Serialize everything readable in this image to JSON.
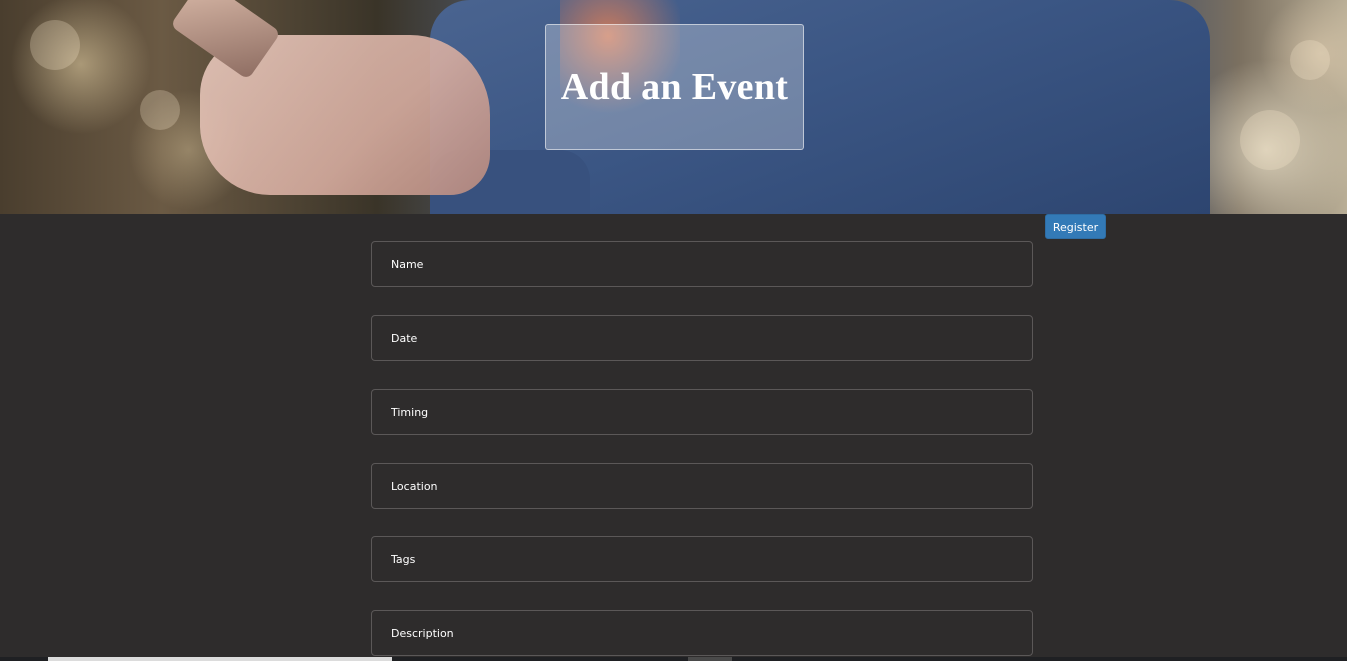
{
  "hero": {
    "title": "Add an Event"
  },
  "register_button": {
    "label": "Register",
    "color": "#337ab7"
  },
  "form": {
    "fields": [
      {
        "placeholder": "Name"
      },
      {
        "placeholder": "Date"
      },
      {
        "placeholder": "Timing"
      },
      {
        "placeholder": "Location"
      },
      {
        "placeholder": "Tags"
      },
      {
        "placeholder": "Description"
      }
    ]
  },
  "colors": {
    "background": "#2e2c2c",
    "field_border": "#5b5858"
  }
}
